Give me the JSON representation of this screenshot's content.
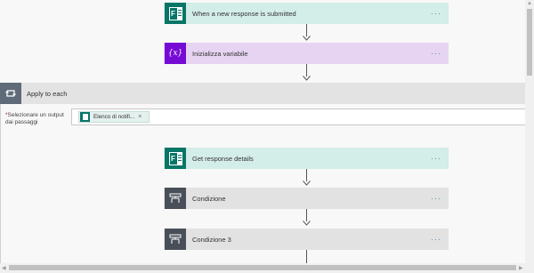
{
  "steps": {
    "trigger": {
      "title": "When a new response is submitted",
      "icon": "forms-icon",
      "more": "···"
    },
    "init_var": {
      "title": "Inizializza variabile",
      "icon": "variable-icon",
      "glyph": "{x}",
      "more": "···"
    },
    "get_details": {
      "title": "Get response details",
      "icon": "forms-icon",
      "more": "···"
    },
    "condition": {
      "title": "Condizione",
      "icon": "condition-icon",
      "more": "···"
    },
    "condition3": {
      "title": "Condizione 3",
      "icon": "condition-icon",
      "more": "···"
    }
  },
  "apply_to_each": {
    "title": "Apply to each",
    "icon": "loop-icon",
    "field_label_required": "*",
    "field_label": "Selezionare un output dai passaggi",
    "token_text": "Elenco di notifi...",
    "token_remove": "×"
  },
  "scrollbar": {
    "up": "▲",
    "left": "◀",
    "right": "▶"
  },
  "colors": {
    "forms": "#077568",
    "variable": "#770bd6",
    "condition": "#484f58",
    "loop": "#5f6b79",
    "more_dots": "#4a90b8"
  }
}
